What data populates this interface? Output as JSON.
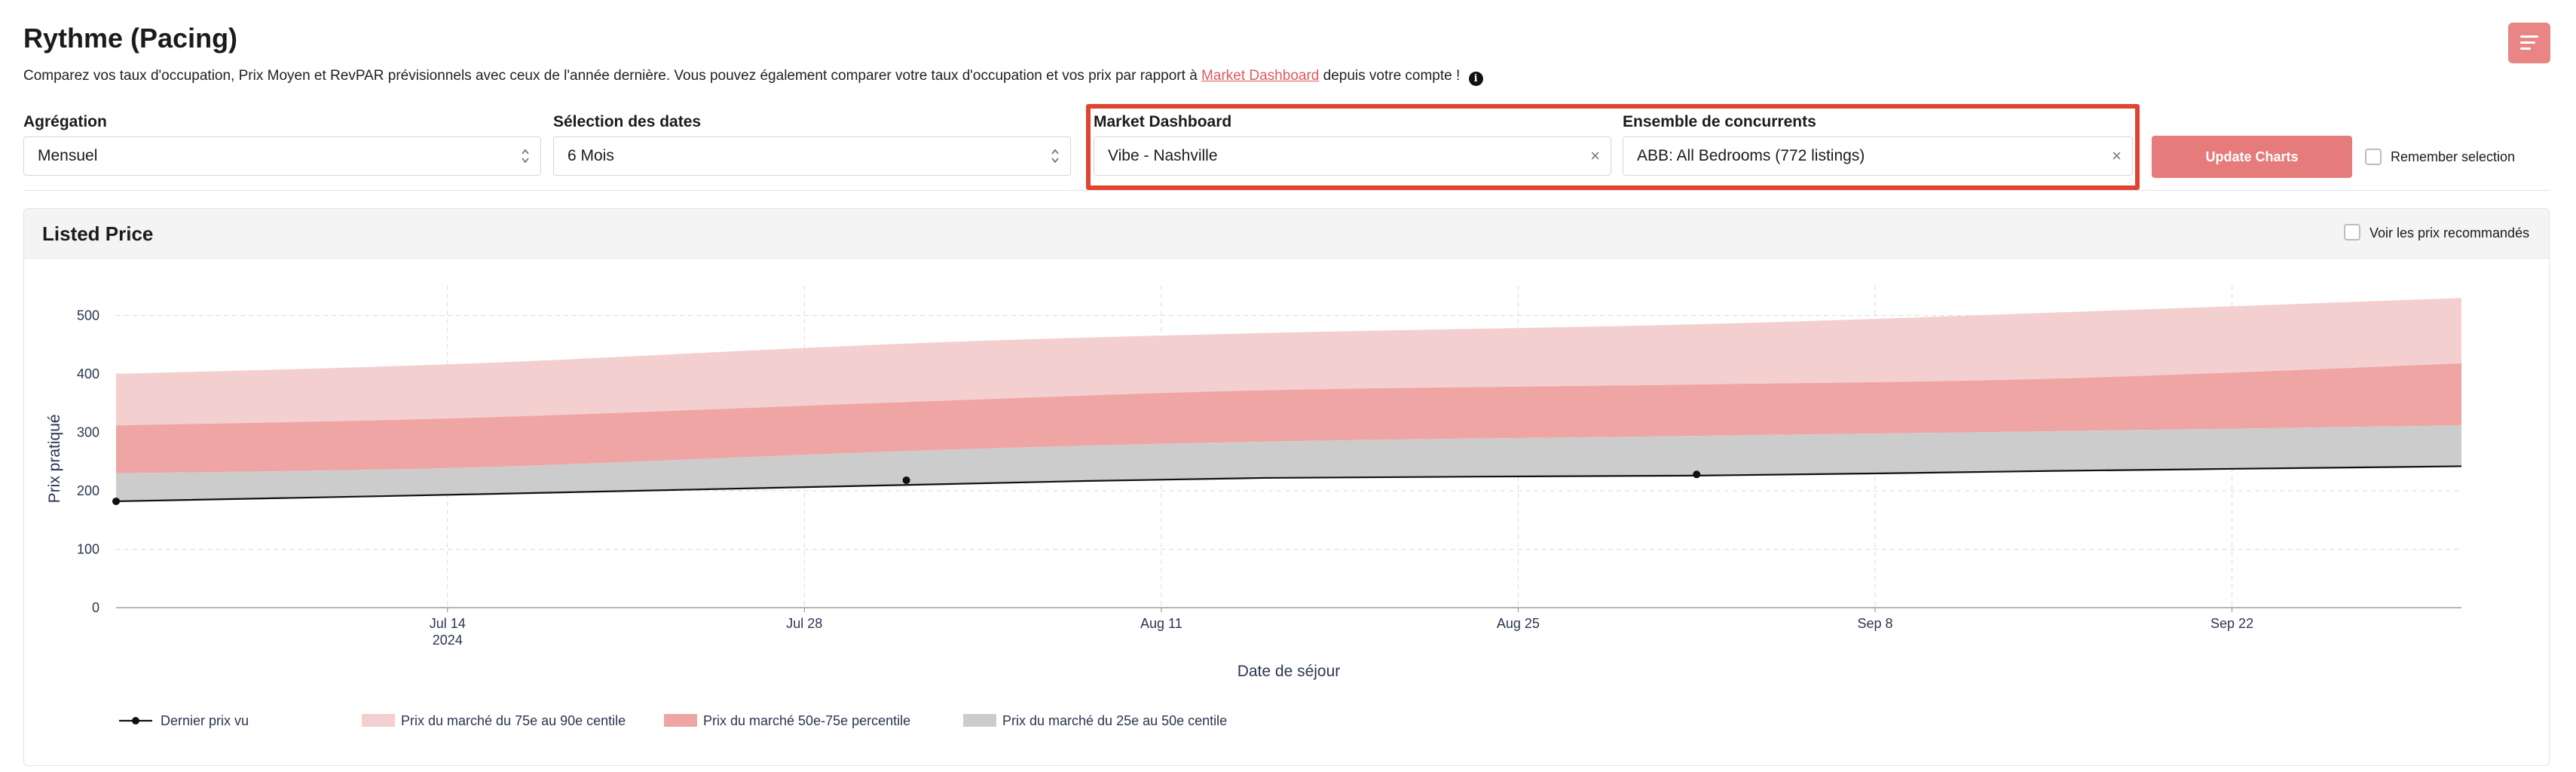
{
  "header": {
    "title": "Rythme (Pacing)",
    "subtitle_before": "Comparez vos taux d'occupation, Prix Moyen et RevPAR prévisionnels avec ceux de l'année dernière. Vous pouvez également comparer votre taux d'occupation et vos prix par rapport à ",
    "subtitle_link": "Market Dashboard",
    "subtitle_after": " depuis votre compte !",
    "info_icon": "i"
  },
  "filters": {
    "aggregation": {
      "label": "Agrégation",
      "value": "Mensuel"
    },
    "dates": {
      "label": "Sélection des dates",
      "value": "6 Mois"
    },
    "market": {
      "label": "Market Dashboard",
      "value": "Vibe - Nashville",
      "clear": "×"
    },
    "compset": {
      "label": "Ensemble de concurrents",
      "value": "ABB: All Bedrooms (772 listings)",
      "clear": "×"
    },
    "update_button": "Update Charts",
    "remember_label": "Remember selection"
  },
  "card": {
    "title": "Listed Price",
    "toggle_label": "Voir les prix recommandés"
  },
  "colors": {
    "accent": "#e67b7b",
    "highlight": "#e0432f",
    "band_75_90": "#f4cfcf",
    "band_50_75": "#f0a5a5",
    "band_25_50": "#cccccc",
    "line": "#111111"
  },
  "chart_data": {
    "type": "area",
    "xlabel": "Date de séjour",
    "ylabel": "Prix pratiqué",
    "ylim": [
      0,
      550
    ],
    "yticks": [
      "0",
      "100",
      "200",
      "300",
      "400",
      "500"
    ],
    "xticks": [
      {
        "label": "Jul 14",
        "sub": "2024"
      },
      {
        "label": "Jul 28",
        "sub": ""
      },
      {
        "label": "Aug 11",
        "sub": ""
      },
      {
        "label": "Aug 25",
        "sub": ""
      },
      {
        "label": "Sep 8",
        "sub": ""
      },
      {
        "label": "Sep 22",
        "sub": ""
      }
    ],
    "x": [
      "2024-07-01",
      "2024-07-15",
      "2024-08-01",
      "2024-08-15",
      "2024-09-01",
      "2024-09-15",
      "2024-10-01"
    ],
    "series": [
      {
        "name": "Prix du marché du 75e au 90e centile",
        "low": [
          312,
          325,
          352,
          372,
          382,
          392,
          418
        ],
        "high": [
          400,
          418,
          452,
          470,
          485,
          505,
          530
        ]
      },
      {
        "name": "Prix du marché 50e-75e percentile",
        "low": [
          230,
          240,
          268,
          284,
          294,
          302,
          312
        ],
        "high": [
          312,
          325,
          352,
          372,
          382,
          392,
          418
        ]
      },
      {
        "name": "Prix du marché du 25e au 50e centile",
        "low": [
          182,
          194,
          210,
          222,
          226,
          234,
          242
        ],
        "high": [
          230,
          240,
          268,
          284,
          294,
          302,
          312
        ]
      },
      {
        "name": "Dernier prix vu",
        "values": [
          182,
          194,
          210,
          222,
          226,
          234,
          242
        ],
        "markers": [
          182,
          218,
          228
        ]
      }
    ],
    "grid": true,
    "legend_position": "bottom"
  }
}
